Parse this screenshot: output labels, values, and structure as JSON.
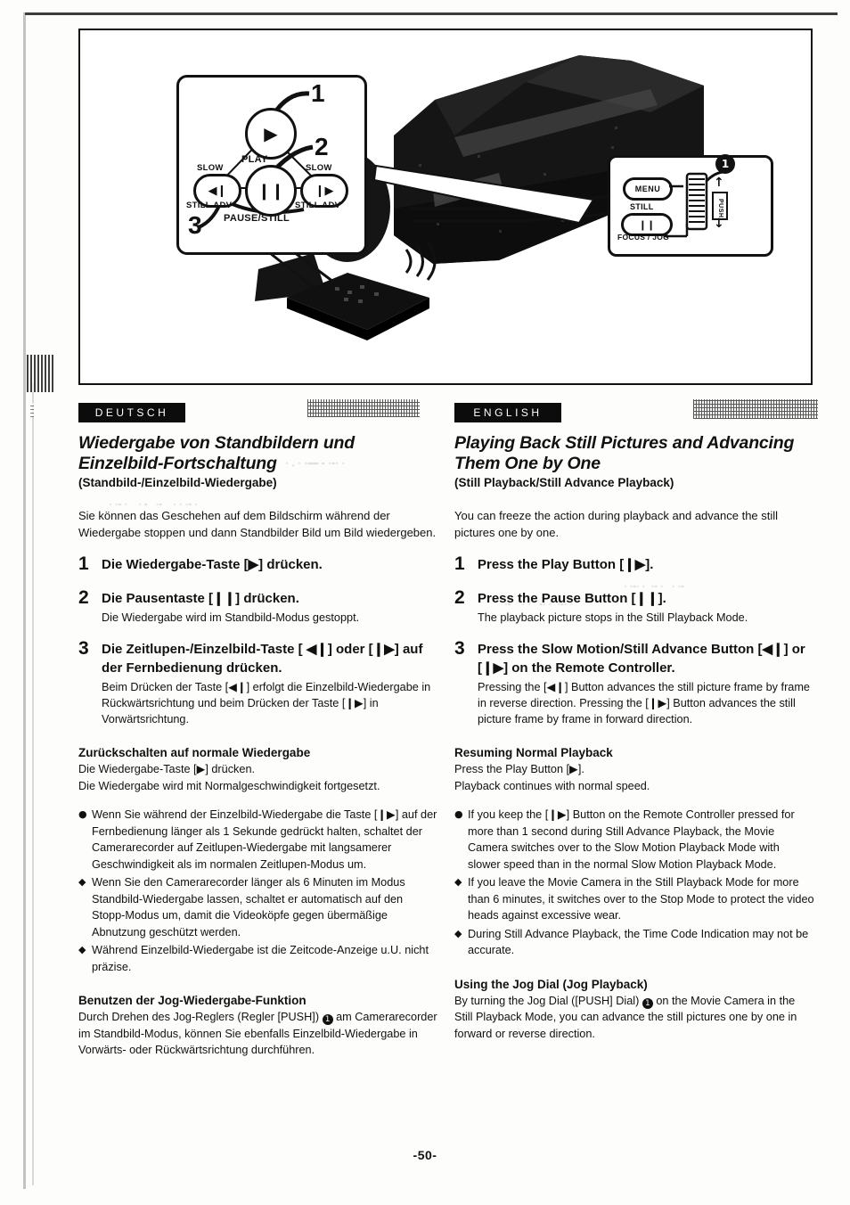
{
  "page": {
    "number": "-50-"
  },
  "illustration": {
    "remote_callout": {
      "name": "remote-control-buttons-callout",
      "play_label": "PLAY",
      "pause_label": "PAUSE/STILL",
      "slow_label_left": "SLOW",
      "still_adv_label_left": "STILL ADV",
      "slow_label_right": "SLOW",
      "still_adv_label_right": "STILL ADV",
      "callout_1": "1",
      "callout_2": "2",
      "callout_3": "3",
      "play_glyph": "▶",
      "pause_glyph": "❙❙",
      "rev_glyph": "◀❙",
      "fwd_glyph": "❙▶"
    },
    "camera_callout": {
      "name": "camera-jog-dial-callout",
      "menu_label": "MENU",
      "still_label": "STILL",
      "still_glyph": "❙❙",
      "focus_jog_label": "FOCUS / JOG",
      "push_label": "PUSH",
      "callout_1": "1",
      "up_arrow": "↑",
      "down_arrow": "↓"
    }
  },
  "german": {
    "lang_bar": "DEUTSCH",
    "title": "Wiedergabe von Standbildern und Einzelbild-Fortschaltung",
    "subtitle": "(Standbild-/Einzelbild-Wiedergabe)",
    "intro": "Sie können das Geschehen auf dem Bildschirm während der Wiedergabe stoppen und dann Standbilder Bild um Bild wiedergeben.",
    "steps": [
      {
        "num": "1",
        "head": "Die Wiedergabe-Taste [▶] drücken.",
        "body": ""
      },
      {
        "num": "2",
        "head": "Die Pausentaste [❙❙] drücken.",
        "body": "Die Wiedergabe wird im Standbild-Modus gestoppt."
      },
      {
        "num": "3",
        "head": "Die Zeitlupen-/Einzelbild-Taste [ ◀❙] oder [❙▶] auf der Fernbedienung drücken.",
        "body": "Beim Drücken der Taste [◀❙] erfolgt die Einzelbild-Wiedergabe in Rückwärtsrichtung und beim Drücken der Taste [❙▶] in Vorwärtsrichtung."
      }
    ],
    "resume_heading": "Zurückschalten auf normale Wiedergabe",
    "resume_line1": "Die Wiedergabe-Taste [▶] drücken.",
    "resume_line2": "Die Wiedergabe wird mit Normalgeschwindigkeit fortgesetzt.",
    "notes": [
      {
        "marker": "●",
        "text": "Wenn Sie während der Einzelbild-Wiedergabe die Taste [❙▶] auf der Fernbedienung länger als 1 Sekunde gedrückt halten, schaltet der Camerarecorder auf Zeitlupen-Wiedergabe mit langsamerer Geschwindigkeit als im normalen Zeitlupen-Modus um."
      },
      {
        "marker": "◆",
        "text": "Wenn Sie den Camerarecorder länger als 6 Minuten im Modus Standbild-Wiedergabe lassen, schaltet er automatisch auf den Stopp-Modus um, damit die Videoköpfe gegen übermäßige Abnutzung geschützt werden."
      },
      {
        "marker": "◆",
        "text": "Während Einzelbild-Wiedergabe ist die Zeitcode-Anzeige u.U. nicht präzise."
      }
    ],
    "jog_heading": "Benutzen der Jog-Wiedergabe-Funktion",
    "jog_body_pre": "Durch Drehen des Jog-Reglers (Regler [PUSH]) ",
    "jog_marker": "1",
    "jog_body_post": " am Camerarecorder im Standbild-Modus, können Sie ebenfalls Einzelbild-Wiedergabe in Vorwärts- oder Rückwärtsrichtung durchführen."
  },
  "english": {
    "lang_bar": "ENGLISH",
    "title": "Playing Back Still Pictures and Advancing Them One by One",
    "subtitle": "(Still Playback/Still Advance Playback)",
    "intro": "You can freeze the action during playback and advance the still pictures one by one.",
    "steps": [
      {
        "num": "1",
        "head": "Press the Play Button [❙▶].",
        "body": ""
      },
      {
        "num": "2",
        "head": "Press the Pause Button [❙❙].",
        "body": "The playback picture stops in the Still Playback Mode."
      },
      {
        "num": "3",
        "head": "Press the Slow Motion/Still Advance Button [◀❙] or [❙▶] on the Remote Controller.",
        "body": "Pressing the [◀❙] Button advances the still picture frame by frame in reverse direction. Pressing the [❙▶] Button advances the still picture frame by frame in forward direction."
      }
    ],
    "resume_heading": "Resuming Normal Playback",
    "resume_line1": "Press the Play Button [▶].",
    "resume_line2": "Playback continues with normal speed.",
    "notes": [
      {
        "marker": "●",
        "text": "If you keep the [❙▶] Button on the Remote Controller pressed for more than 1 second during Still Advance Playback, the Movie Camera switches over to the Slow Motion Playback Mode with slower speed than in the normal Slow Motion Playback Mode."
      },
      {
        "marker": "◆",
        "text": "If you leave the Movie Camera in the Still Playback Mode for more than 6 minutes, it switches over to the Stop Mode to protect the video heads against excessive wear."
      },
      {
        "marker": "◆",
        "text": "During Still Advance Playback, the Time Code Indication may not be accurate."
      }
    ],
    "jog_heading": "Using the Jog Dial (Jog Playback)",
    "jog_body_pre": "By turning the Jog Dial ([PUSH] Dial) ",
    "jog_marker": "1",
    "jog_body_post": " on the Movie Camera in the Still Playback Mode, you can advance the still pictures one by one in forward or reverse direction."
  }
}
